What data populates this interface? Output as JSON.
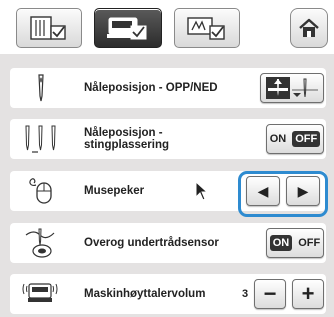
{
  "tabs": [
    {
      "icon": "page-settings-icon",
      "active": false
    },
    {
      "icon": "machine-settings-icon",
      "active": true
    },
    {
      "icon": "embroidery-settings-icon",
      "active": false
    }
  ],
  "home": {
    "icon": "home-icon"
  },
  "rows": [
    {
      "icon": "needle-icon",
      "label": "Nåleposisjon - OPP/NED",
      "control": "needle-up-down-button"
    },
    {
      "icon": "stitch-placement-icon",
      "label": "Nåleposisjon -\nstingplassering",
      "on_label": "ON",
      "off_label": "OFF",
      "selected": "off"
    },
    {
      "icon": "mouse-icon",
      "label": "Musepeker",
      "prev": "◀",
      "next": "▶"
    },
    {
      "icon": "thread-sensor-icon",
      "label": "Overog undertrådsensor",
      "on_label": "ON",
      "off_label": "OFF",
      "selected": "on"
    },
    {
      "icon": "speaker-icon",
      "label": "Maskinhøyttalervolum",
      "value": "3",
      "minus": "−",
      "plus": "+"
    }
  ],
  "colors": {
    "highlight": "#2e8bd0",
    "background": "#e4e2e2"
  }
}
